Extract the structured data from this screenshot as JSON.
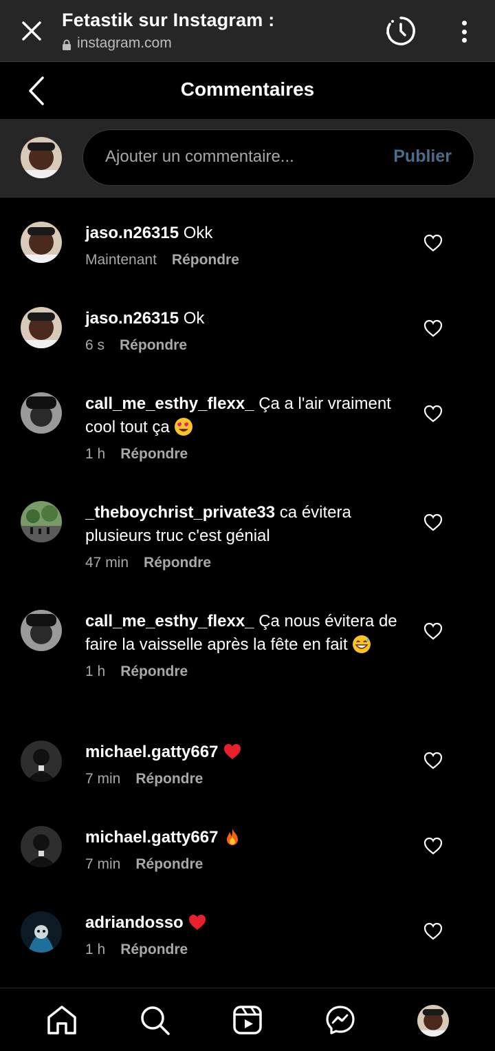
{
  "browser": {
    "title": "Fetastik sur Instagram :",
    "url": "instagram.com"
  },
  "header": {
    "title": "Commentaires"
  },
  "composer": {
    "placeholder": "Ajouter un commentaire...",
    "publish_label": "Publier"
  },
  "comments": [
    {
      "user": "jaso.n26315",
      "text": "Okk",
      "time": "Maintenant",
      "reply": "Répondre"
    },
    {
      "user": "jaso.n26315",
      "text": "Ok",
      "time": "6 s",
      "reply": "Répondre"
    },
    {
      "user": "call_me_esthy_flexx_",
      "text": "Ça a l'air vraiment cool tout ça",
      "emoji": "heart-eyes-emoji",
      "time": "1 h",
      "reply": "Répondre"
    },
    {
      "user": "_theboychrist_private33",
      "text": "ca évitera plusieurs truc c'est génial",
      "time": "47 min",
      "reply": "Répondre"
    },
    {
      "user": "call_me_esthy_flexx_",
      "text": "Ça nous évitera de faire la vaisselle après la fête en fait",
      "emoji": "grinning-sweat-emoji",
      "time": "1 h",
      "reply": "Répondre"
    },
    {
      "user": "michael.gatty667",
      "text": "",
      "emoji": "red-heart-emoji",
      "time": "7 min",
      "reply": "Répondre"
    },
    {
      "user": "michael.gatty667",
      "text": "",
      "emoji": "fire-emoji",
      "time": "7 min",
      "reply": "Répondre"
    },
    {
      "user": "adriandosso",
      "text": "",
      "emoji": "red-heart-emoji",
      "time": "1 h",
      "reply": "Répondre"
    }
  ],
  "nav": {
    "items": [
      "home-icon",
      "search-icon",
      "reels-icon",
      "messenger-icon",
      "profile-avatar"
    ]
  },
  "colors": {
    "background": "#000000",
    "bar": "#262626",
    "muted": "#a8a8a8",
    "publish": "#4a6d8c"
  }
}
